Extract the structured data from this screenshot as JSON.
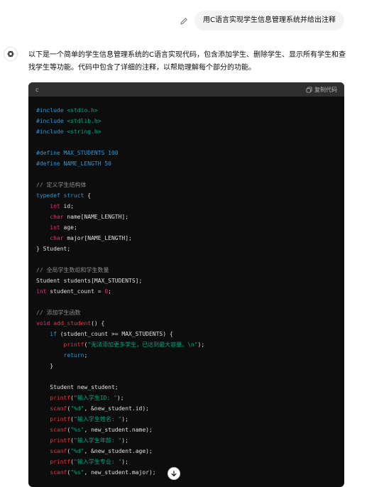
{
  "user_message": "用C语言实现学生信息管理系统并给出注释",
  "assistant_intro": "以下是一个简单的学生信息管理系统的C语言实现代码，包含添加学生、删除学生、显示所有学生和查找学生等功能。代码中包含了详细的注释，以帮助理解每个部分的功能。",
  "code_block": {
    "language": "c",
    "copy_label": "复制代码",
    "lines": [
      [
        [
          "pp",
          "#include "
        ],
        [
          "st",
          "<stdio.h>"
        ]
      ],
      [
        [
          "pp",
          "#include "
        ],
        [
          "st",
          "<stdlib.h>"
        ]
      ],
      [
        [
          "pp",
          "#include "
        ],
        [
          "st",
          "<string.h>"
        ]
      ],
      [],
      [
        [
          "pp",
          "#define MAX_STUDENTS 100"
        ]
      ],
      [
        [
          "pp",
          "#define NAME_LENGTH 50"
        ]
      ],
      [],
      [
        [
          "cm",
          "// 定义学生结构体"
        ]
      ],
      [
        [
          "kw",
          "typedef "
        ],
        [
          "kw",
          "struct "
        ],
        [
          "",
          "{"
        ]
      ],
      [
        [
          "",
          "    "
        ],
        [
          "ty",
          "int "
        ],
        [
          "",
          "id;"
        ]
      ],
      [
        [
          "",
          "    "
        ],
        [
          "ty",
          "char "
        ],
        [
          "",
          "name[NAME_LENGTH];"
        ]
      ],
      [
        [
          "",
          "    "
        ],
        [
          "ty",
          "int "
        ],
        [
          "",
          "age;"
        ]
      ],
      [
        [
          "",
          "    "
        ],
        [
          "ty",
          "char "
        ],
        [
          "",
          "major[NAME_LENGTH];"
        ]
      ],
      [
        [
          "",
          "} Student;"
        ]
      ],
      [],
      [
        [
          "cm",
          "// 全局学生数组和学生数量"
        ]
      ],
      [
        [
          "",
          "Student students[MAX_STUDENTS];"
        ]
      ],
      [
        [
          "ty",
          "int "
        ],
        [
          "",
          "student_count = "
        ],
        [
          "nm",
          "0"
        ],
        [
          "",
          ";"
        ]
      ],
      [],
      [
        [
          "cm",
          "// 添加学生函数"
        ]
      ],
      [
        [
          "ty",
          "void "
        ],
        [
          "fn",
          "add_student"
        ],
        [
          "",
          "() {"
        ]
      ],
      [
        [
          "",
          "    "
        ],
        [
          "kw",
          "if "
        ],
        [
          "",
          "(student_count >= MAX_STUDENTS) {"
        ]
      ],
      [
        [
          "",
          "        "
        ],
        [
          "fn",
          "printf"
        ],
        [
          "",
          "("
        ],
        [
          "st",
          "\"无法添加更多学生，已达到最大容量。\\n\""
        ],
        [
          "",
          ");"
        ]
      ],
      [
        [
          "",
          "        "
        ],
        [
          "kw",
          "return"
        ],
        [
          "",
          ";"
        ]
      ],
      [
        [
          "",
          "    }"
        ]
      ],
      [],
      [
        [
          "",
          "    Student new_student;"
        ]
      ],
      [
        [
          "",
          "    "
        ],
        [
          "fn",
          "printf"
        ],
        [
          "",
          "("
        ],
        [
          "st",
          "\"输入学生ID: \""
        ],
        [
          "",
          ");"
        ]
      ],
      [
        [
          "",
          "    "
        ],
        [
          "fn",
          "scanf"
        ],
        [
          "",
          "("
        ],
        [
          "st",
          "\"%d\""
        ],
        [
          "",
          ", &new_student.id);"
        ]
      ],
      [
        [
          "",
          "    "
        ],
        [
          "fn",
          "printf"
        ],
        [
          "",
          "("
        ],
        [
          "st",
          "\"输入学生姓名: \""
        ],
        [
          "",
          ");"
        ]
      ],
      [
        [
          "",
          "    "
        ],
        [
          "fn",
          "scanf"
        ],
        [
          "",
          "("
        ],
        [
          "st",
          "\"%s\""
        ],
        [
          "",
          ", new_student.name);"
        ]
      ],
      [
        [
          "",
          "    "
        ],
        [
          "fn",
          "printf"
        ],
        [
          "",
          "("
        ],
        [
          "st",
          "\"输入学生年龄: \""
        ],
        [
          "",
          ");"
        ]
      ],
      [
        [
          "",
          "    "
        ],
        [
          "fn",
          "scanf"
        ],
        [
          "",
          "("
        ],
        [
          "st",
          "\"%d\""
        ],
        [
          "",
          ", &new_student.age);"
        ]
      ],
      [
        [
          "",
          "    "
        ],
        [
          "fn",
          "printf"
        ],
        [
          "",
          "("
        ],
        [
          "st",
          "\"输入学生专业: \""
        ],
        [
          "",
          ");"
        ]
      ],
      [
        [
          "",
          "    "
        ],
        [
          "fn",
          "scanf"
        ],
        [
          "",
          "("
        ],
        [
          "st",
          "\"%s\""
        ],
        [
          "",
          ", new_student.major);"
        ]
      ]
    ]
  },
  "colors": {
    "code_bg": "#0d0d0d",
    "code_header_bg": "#2f2f2f",
    "keyword": "#2e95d3",
    "type": "#df3079",
    "string": "#00a67d",
    "comment": "#8a8a8a",
    "function": "#f22c3d",
    "user_bubble_bg": "#f4f4f4"
  },
  "icons": {
    "edit": "pencil-icon",
    "avatar": "openai-logo-icon",
    "copy": "copy-icon",
    "scroll_down": "arrow-down-icon"
  }
}
